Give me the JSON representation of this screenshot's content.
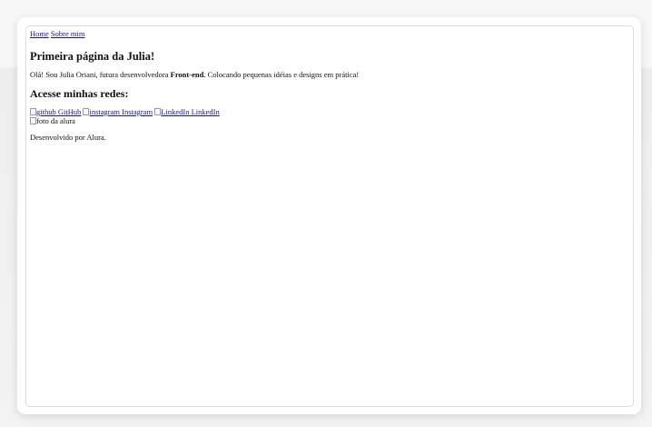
{
  "nav": {
    "home_label": "Home",
    "about_label": "Sobre mim"
  },
  "main": {
    "title": "Primeira página da Julia!",
    "intro_before": "Olá! Sou Julia Oriani, futura desenvolvedora ",
    "intro_bold": "Front-end.",
    "intro_after": " Colocando pequenas idéias e designs em prática!",
    "networks_heading": "Acesse minhas redes:"
  },
  "socials": {
    "github": {
      "alt": "github",
      "label": "GitHub",
      "icon": "github-icon"
    },
    "instagram": {
      "alt": "instagram",
      "label": "Instagram",
      "icon": "instagram-icon"
    },
    "linkedin": {
      "alt": "LinkedIn",
      "label": "LinkedIn",
      "icon": "linkedin-icon"
    }
  },
  "photo": {
    "alt": "foto da alura"
  },
  "footer": {
    "text": "Desenvolvido por Alura."
  }
}
